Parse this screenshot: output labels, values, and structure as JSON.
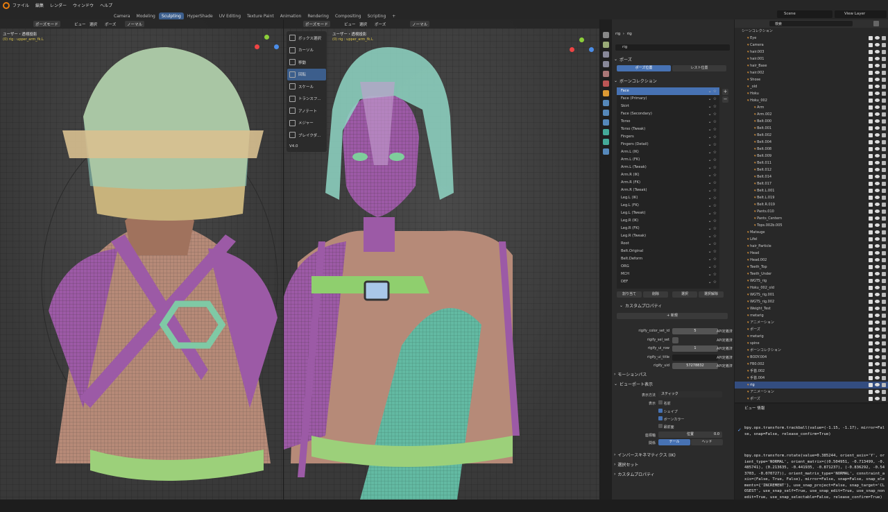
{
  "menu": [
    "ファイル",
    "編集",
    "レンダー",
    "ウィンドウ",
    "ヘルプ"
  ],
  "workspaces": [
    "Camera",
    "Modeling",
    "Sculpting",
    "HyperShade",
    "UV Editing",
    "Texture Paint",
    "Animation",
    "Rendering",
    "Compositing",
    "Scripting"
  ],
  "active_workspace": "Sculpting",
  "scene": "Scene",
  "view_layer": "View Layer",
  "viewport_left": {
    "header": [
      "ポーズモード",
      "ビュー",
      "選択",
      "ポーズ",
      "ノーマル"
    ],
    "label": "ユーザー・透視投影",
    "sublabel": "(0) rig : upper_arm_fk.L"
  },
  "viewport_right": {
    "header": [
      "ポーズモード",
      "ビュー",
      "選択",
      "ポーズ",
      "ノーマル"
    ],
    "label": "ユーザー・透視投影",
    "sublabel": "(0) rig : upper_arm_fk.L"
  },
  "toolmenu": [
    "ボックス選択",
    "カーソル",
    "移動",
    "回転",
    "スケール",
    "トランスフ...",
    "アノテート",
    "メジャー",
    "ブレイクダ..."
  ],
  "toolmenu_active": "回転",
  "version": "V4.0",
  "properties": {
    "object": "rig",
    "data": "rig",
    "search": "rig",
    "pose_section": "ポーズ",
    "pose_btn": "ポーズ位置",
    "rest_btn": "レスト位置",
    "bone_collections_section": "ボーンコレクション",
    "bone_collections": [
      "Face",
      "Face (Primary)",
      "Skirt",
      "Face (Secondary)",
      "Torso",
      "Torso (Tweak)",
      "Fingers",
      "Fingers (Detail)",
      "Arm.L (IK)",
      "Arm.L (FK)",
      "Arm.L (Tweak)",
      "Arm.R (IK)",
      "Arm.R (FK)",
      "Arm.R (Tweak)",
      "Leg.L (IK)",
      "Leg.L (FK)",
      "Leg.L (Tweak)",
      "Leg.R (IK)",
      "Leg.R (FK)",
      "Leg.R (Tweak)",
      "Root",
      "Belt.Original",
      "Belt.Deform",
      "ORG",
      "MCH",
      "DEF"
    ],
    "bc_buttons": [
      "割り当て",
      "削除",
      "選択",
      "選択解除"
    ],
    "custom_props_section": "カスタムプロパティ",
    "new_btn": "新規",
    "custom_props": [
      {
        "key": "rigify_color_set_id",
        "value": "5",
        "api": "API定義済"
      },
      {
        "key": "rigify_sel_set",
        "value": "",
        "api": "API定義済"
      },
      {
        "key": "rigify_ui_row",
        "value": "1",
        "api": "API定義済"
      },
      {
        "key": "rigify_ui_title",
        "value": "",
        "api": "API定義済"
      },
      {
        "key": "rigify_uid",
        "value": "57278832",
        "api": "API定義済"
      }
    ],
    "motion_paths": "モーションパス",
    "viewport_display": "ビューポート表示",
    "display_as_label": "表示方法",
    "display_as": "スティック",
    "show_label": "表示",
    "show_names": "名前",
    "show_shapes": "シェイプ",
    "show_bone_colors": "ボーンカラー",
    "in_front": "最前面",
    "axes_label": "座標軸",
    "axes_pos": "位置",
    "axes_val": "0.0",
    "relations_label": "関係",
    "tail_btn": "テール",
    "head_btn": "ヘッド",
    "ik_section": "インバースキネマティクス (IK)",
    "selection_sets": "選択セット",
    "custom_props2": "カスタムプロパティ"
  },
  "outliner": {
    "search": "検索",
    "title": "シーンコレクション",
    "rows": [
      "Eye",
      "Camera",
      "hair.003",
      "hair.001",
      "hair_Base",
      "hair.002",
      "Shose",
      "_old",
      "Hoku",
      "Hoku_002",
      "Arm",
      "Arm.002",
      "Belt.000",
      "Belt.001",
      "Belt.002",
      "Belt.004",
      "Belt.008",
      "Belt.009",
      "Belt.011",
      "Belt.012",
      "Belt.014",
      "Belt.017",
      "Belt.L.001",
      "Belt.L.019",
      "Belt.R.019",
      "Pants.010",
      "Pants_Centern",
      "Tops.002b.005",
      "Matsuge",
      "Lifel",
      "hair_Particle",
      "Head",
      "Head.002",
      "Teeth_Top",
      "Teeth_Under",
      "WGTS_rig",
      "Hoku_002_old",
      "WGTS_rig.001",
      "WGTS_rig.002",
      "Weight_Test",
      "metarig",
      "アニメーション",
      "ポーズ",
      "metarig",
      "spine",
      "ボーンコレクション",
      "BODY.004",
      "FB0.002",
      "手首.002",
      "手首.004",
      "rig",
      "アニメーション",
      "ポーズ"
    ],
    "selected": "rig"
  },
  "info": {
    "tabs": "ビュー  情報",
    "line1": "bpy.ops.transform.trackball(value=(-1.15, -1.17), mirror=False, snap=False, release_confirm=True)",
    "line2": "bpy.ops.transform.rotate(value=0.385244, orient_axis='Y', orient_type='NORMAL', orient_matrix=((0.504951, -0.713499, -0.485741), (0.213635, -0.441935, -0.871237), (-0.836292, -0.543703, -0.070727)), orient_matrix_type='NORMAL', constraint_axis=(False, True, False), mirror=False, snap=False, snap_elements={'INCREMENT'}, use_snap_project=False, snap_target='CLOSEST', use_snap_self=True, use_snap_edit=True, use_snap_nonedit=True, use_snap_selectable=False, release_confirm=True)"
  }
}
